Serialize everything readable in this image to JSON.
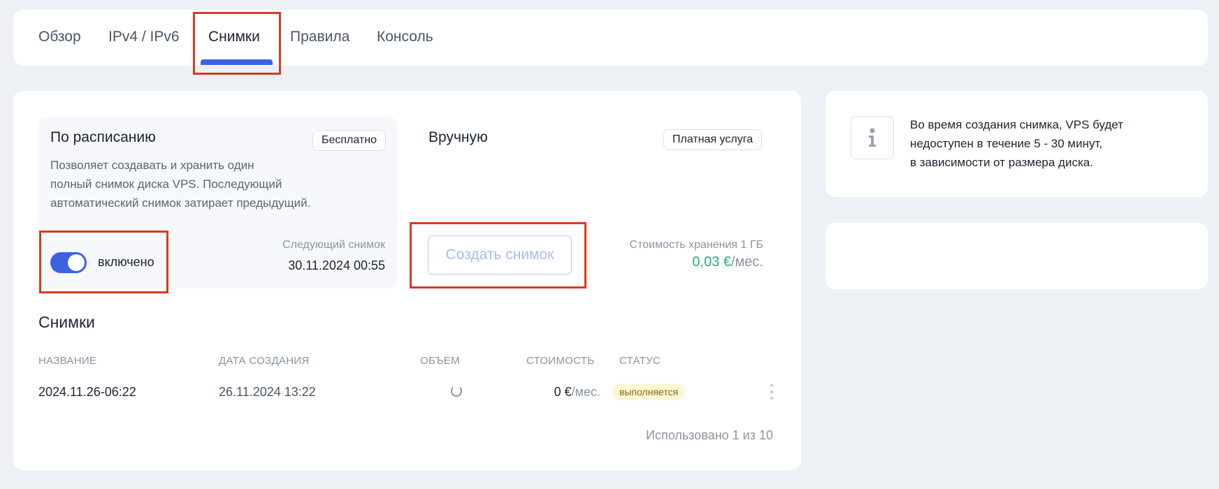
{
  "tabs": [
    {
      "label": "Обзор",
      "active": false
    },
    {
      "label": "IPv4 / IPv6",
      "active": false
    },
    {
      "label": "Снимки",
      "active": true
    },
    {
      "label": "Правила",
      "active": false
    },
    {
      "label": "Консоль",
      "active": false
    }
  ],
  "scheduled": {
    "title": "По расписанию",
    "badge": "Бесплатно",
    "description": "Позволяет создавать и хранить один\nполный снимок диска VPS. Последующий\nавтоматический снимок затирает предыдущий.",
    "toggle_label": "включено",
    "toggle_on": true,
    "next_label": "Следующий снимок",
    "next_value": "30.11.2024 00:55"
  },
  "manual": {
    "title": "Вручную",
    "badge": "Платная услуга",
    "create_button": "Создать снимок",
    "storage_label": "Стоимость хранения 1 ГБ",
    "storage_price": "0,03 €",
    "storage_unit": "/мес."
  },
  "snapshots": {
    "title": "Снимки",
    "columns": [
      "НАЗВАНИЕ",
      "ДАТА СОЗДАНИЯ",
      "ОБЪЕМ",
      "СТОИМОСТЬ",
      "СТАТУС"
    ],
    "rows": [
      {
        "name": "2024.11.26-06:22",
        "created": "26.11.2024 13:22",
        "cost": "0 €",
        "cost_unit": "/мес.",
        "status": "выполняется"
      }
    ],
    "usage": "Использовано 1 из 10"
  },
  "info": {
    "icon": "info-icon",
    "text": "Во время создания снимка, VPS будет\nнедоступен в течение 5 - 30 минут,\nв зависимости от размера диска."
  },
  "colors": {
    "accent": "#3c62e0",
    "price_green": "#23b07a",
    "highlight": "#d93a1f",
    "status_bg": "#fdf7d6"
  }
}
